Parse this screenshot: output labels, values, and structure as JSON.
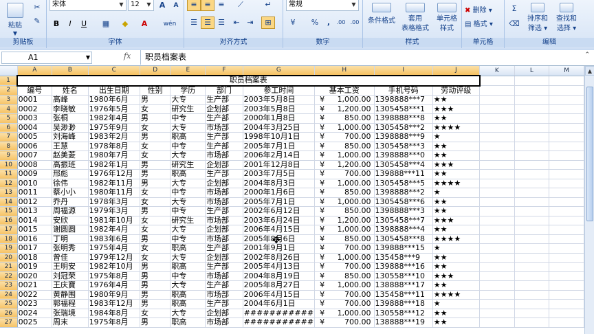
{
  "ribbon": {
    "clipboard": {
      "paste": "粘贴",
      "label": "剪贴板"
    },
    "font": {
      "name": "宋体",
      "size": "12",
      "bold": "B",
      "italic": "I",
      "underline": "U",
      "label": "字体",
      "grow": "A",
      "shrink": "A",
      "wen": "wén"
    },
    "alignment": {
      "label": "对齐方式"
    },
    "number": {
      "format": "常规",
      "label": "数字",
      "percent": "%",
      "comma": ",",
      "inc": ".00",
      "dec": ".00"
    },
    "styles": {
      "cond": "条件格式",
      "table1": "套用",
      "table2": "表格格式",
      "cell1": "单元格",
      "cell2": "样式",
      "label": "样式"
    },
    "cells": {
      "delete": "删除",
      "format": "格式",
      "label": "单元格"
    },
    "editing": {
      "sort1": "排序和",
      "sort2": "筛选",
      "find1": "查找和",
      "find2": "选择",
      "label": "编辑"
    }
  },
  "formula_bar": {
    "name_box": "A1",
    "fx": "fx",
    "value": "职员档案表"
  },
  "columns": [
    "A",
    "B",
    "C",
    "D",
    "E",
    "F",
    "G",
    "H",
    "I",
    "J",
    "K",
    "L",
    "M"
  ],
  "title": "职员档案表",
  "headers": [
    "编号",
    "姓名",
    "出生日期",
    "性别",
    "学历",
    "部门",
    "参工时间",
    "基本工资",
    "手机号码",
    "劳动评级"
  ],
  "rows": [
    [
      "0001",
      "高峰",
      "1980年6月",
      "男",
      "大专",
      "生产部",
      "2003年5月8日",
      "¥",
      "1,000.00",
      "1398888***7",
      "★★"
    ],
    [
      "0002",
      "李晓敏",
      "1976年5月",
      "女",
      "研究生",
      "企划部",
      "2003年5月8日",
      "¥",
      "1,200.00",
      "1305458***1",
      "★★★"
    ],
    [
      "0003",
      "张桐",
      "1982年4月",
      "男",
      "中专",
      "生产部",
      "2000年1月8日",
      "¥",
      "850.00",
      "1398888***8",
      "★★"
    ],
    [
      "0004",
      "吴渺渺",
      "1975年9月",
      "女",
      "大专",
      "市场部",
      "2004年3月25日",
      "¥",
      "1,000.00",
      "1305458***2",
      "★★★★"
    ],
    [
      "0005",
      "刘海峰",
      "1983年2月",
      "男",
      "职高",
      "生产部",
      "1998年10月1日",
      "¥",
      "700.00",
      "1398888***9",
      "★"
    ],
    [
      "0006",
      "王慧",
      "1978年8月",
      "女",
      "中专",
      "生产部",
      "2005年7月1日",
      "¥",
      "850.00",
      "1305458***3",
      "★★"
    ],
    [
      "0007",
      "赵美菱",
      "1980年7月",
      "女",
      "大专",
      "市场部",
      "2006年2月14日",
      "¥",
      "1,000.00",
      "1398888***0",
      "★★"
    ],
    [
      "0008",
      "高振班",
      "1982年1月",
      "男",
      "研究生",
      "企划部",
      "2001年12月8日",
      "¥",
      "1,200.00",
      "1305458***4",
      "★★★"
    ],
    [
      "0009",
      "邢彪",
      "1976年12月",
      "男",
      "职高",
      "生产部",
      "2003年7月5日",
      "¥",
      "700.00",
      "139888***11",
      "★★"
    ],
    [
      "0010",
      "徐伟",
      "1982年11月",
      "男",
      "大专",
      "企划部",
      "2004年8月3日",
      "¥",
      "1,000.00",
      "1305458***5",
      "★★★★"
    ],
    [
      "0011",
      "蔡小小",
      "1980年11月",
      "女",
      "中专",
      "市场部",
      "2000年1月6日",
      "¥",
      "850.00",
      "1398888***2",
      "★"
    ],
    [
      "0012",
      "乔丹",
      "1978年3月",
      "女",
      "大专",
      "市场部",
      "2005年7月1日",
      "¥",
      "1,000.00",
      "1305458***6",
      "★★"
    ],
    [
      "0013",
      "周福源",
      "1979年3月",
      "男",
      "中专",
      "生产部",
      "2002年6月12日",
      "¥",
      "850.00",
      "1398888***3",
      "★★"
    ],
    [
      "0014",
      "安欣",
      "1981年10月",
      "女",
      "研究生",
      "市场部",
      "2003年6月24日",
      "¥",
      "1,200.00",
      "1305458***7",
      "★★★"
    ],
    [
      "0015",
      "谢圆圆",
      "1982年4月",
      "女",
      "大专",
      "企划部",
      "2006年4月15日",
      "¥",
      "1,000.00",
      "1398888***4",
      "★★"
    ],
    [
      "0016",
      "丁明",
      "1983年6月",
      "男",
      "中专",
      "市场部",
      "2005年8月6日",
      "¥",
      "850.00",
      "1305458***8",
      "★★★★"
    ],
    [
      "0017",
      "张明秀",
      "1975年4月",
      "女",
      "职高",
      "生产部",
      "2001年9月1日",
      "¥",
      "700.00",
      "139888***15",
      "★"
    ],
    [
      "0018",
      "曾佳",
      "1979年12月",
      "女",
      "大专",
      "企划部",
      "2002年8月26日",
      "¥",
      "1,000.00",
      "135458***9",
      "★★"
    ],
    [
      "0019",
      "王明安",
      "1982年10月",
      "男",
      "职高",
      "生产部",
      "2005年4月13日",
      "¥",
      "700.00",
      "139888***16",
      "★★"
    ],
    [
      "0020",
      "刘冠荣",
      "1975年8月",
      "男",
      "中专",
      "市场部",
      "2004年8月19日",
      "¥",
      "850.00",
      "130558***10",
      "★★★"
    ],
    [
      "0021",
      "王庆寶",
      "1976年4月",
      "男",
      "大专",
      "生产部",
      "2005年8月27日",
      "¥",
      "1,000.00",
      "138888***17",
      "★★"
    ],
    [
      "0022",
      "黄静围",
      "1980年9月",
      "男",
      "职高",
      "市场部",
      "2006年4月15日",
      "¥",
      "700.00",
      "135458***11",
      "★★★★"
    ],
    [
      "0023",
      "郭福程",
      "1983年12月",
      "男",
      "职高",
      "生产部",
      "2004年6月1日",
      "¥",
      "700.00",
      "139888***18",
      "★"
    ],
    [
      "0024",
      "张瑞境",
      "1984年8月",
      "女",
      "大专",
      "企划部",
      "###########",
      "¥",
      "1,000.00",
      "130558***12",
      "★★"
    ],
    [
      "0025",
      "周末",
      "1975年8月",
      "男",
      "职高",
      "市场部",
      "###########",
      "¥",
      "700.00",
      "138888***19",
      "★★"
    ]
  ],
  "row_numbers": [
    "1",
    "2",
    "3",
    "4",
    "5",
    "6",
    "7",
    "8",
    "9",
    "10",
    "11",
    "12",
    "13",
    "14",
    "15",
    "16",
    "17",
    "18",
    "19",
    "20",
    "21",
    "22",
    "23",
    "24",
    "25",
    "26",
    "27"
  ]
}
